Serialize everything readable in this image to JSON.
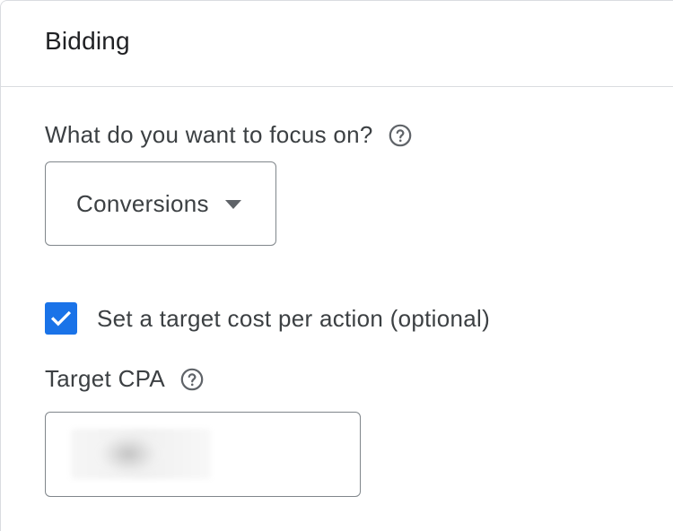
{
  "header": {
    "title": "Bidding"
  },
  "focus": {
    "label": "What do you want to focus on?",
    "help_icon": "help-circle-icon",
    "dropdown_value": "Conversions",
    "dropdown_icon": "caret-down-icon"
  },
  "target_cost": {
    "checkbox_checked": true,
    "checkbox_label": "Set a target cost per action (optional)"
  },
  "target_cpa": {
    "label": "Target CPA",
    "help_icon": "help-circle-icon",
    "value": ""
  },
  "colors": {
    "accent": "#1a73e8",
    "text": "#3c4043",
    "border": "#80868b",
    "divider": "#dadce0"
  }
}
